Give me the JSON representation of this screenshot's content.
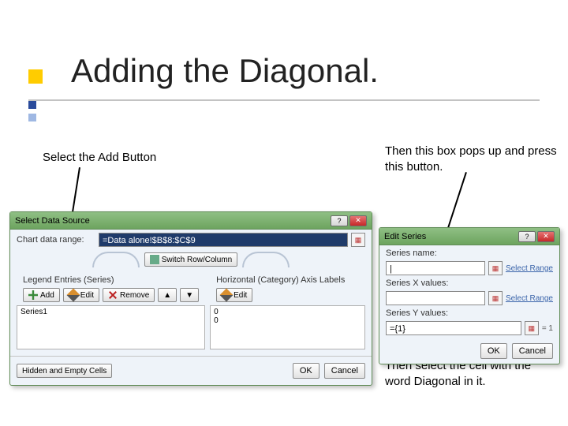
{
  "title": "Adding the Diagonal.",
  "captions": {
    "left": "Select the Add Button",
    "right": "Then this box pops up and press this button.",
    "bottom": "Then select the cell with the word Diagonal in it."
  },
  "window_common": {
    "help": "?",
    "close": "✕"
  },
  "source_dialog": {
    "title": "Select Data Source",
    "chart_range_label": "Chart data range:",
    "chart_range_value": "=Data alone!$B$8:$C$9",
    "switch_btn": "Switch Row/Column",
    "legend_header": "Legend Entries (Series)",
    "axis_header": "Horizontal (Category) Axis Labels",
    "add": "Add",
    "edit": "Edit",
    "remove": "Remove",
    "axis_edit": "Edit",
    "series1": "Series1",
    "axis_values": [
      "0",
      "0"
    ],
    "hidden_btn": "Hidden and Empty Cells",
    "ok": "OK",
    "cancel": "Cancel"
  },
  "edit_dialog": {
    "title": "Edit Series",
    "name_label": "Series name:",
    "x_label": "Series X values:",
    "y_label": "Series Y values:",
    "y_value": "={1}",
    "y_preview": "= 1",
    "select_range": "Select Range",
    "ok": "OK",
    "cancel": "Cancel"
  }
}
